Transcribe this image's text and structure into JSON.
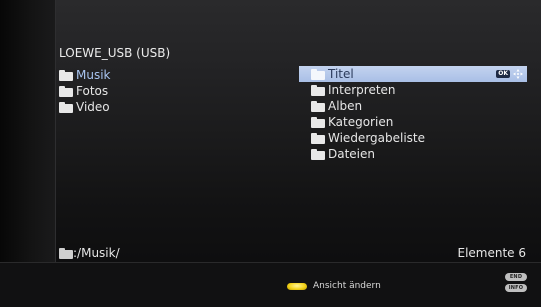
{
  "device_title": "LOEWE_USB (USB)",
  "left_list": [
    {
      "label": "Musik",
      "active": true
    },
    {
      "label": "Fotos",
      "active": false
    },
    {
      "label": "Video",
      "active": false
    }
  ],
  "right_list": [
    {
      "label": "Titel",
      "selected": true
    },
    {
      "label": "Interpreten",
      "selected": false
    },
    {
      "label": "Alben",
      "selected": false
    },
    {
      "label": "Kategorien",
      "selected": false
    },
    {
      "label": "Wiedergabeliste",
      "selected": false
    },
    {
      "label": "Dateien",
      "selected": false
    }
  ],
  "ok_hint": {
    "ok_label": "OK",
    "icon": "dpad-navigation-icon"
  },
  "status": {
    "path": ":/Musik/",
    "elements_count": "Elemente 6"
  },
  "footer": {
    "yellow_action": "Ansicht ändern",
    "end_key": "END",
    "info_key": "INFO"
  },
  "colors": {
    "selection": "#b6c9ea",
    "active_text": "#a8c4f0",
    "yellow_button": "#f3d21a"
  }
}
